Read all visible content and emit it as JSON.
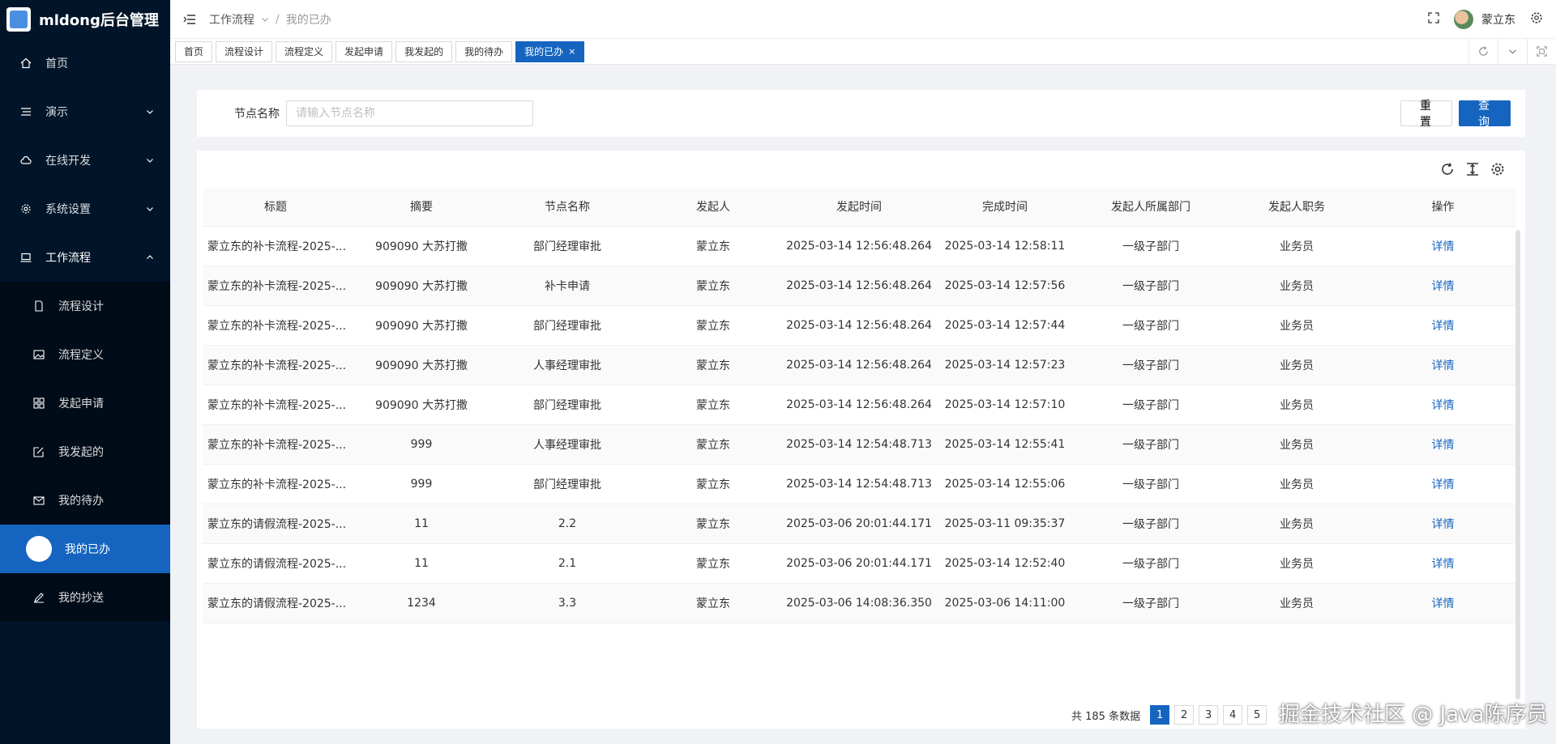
{
  "app": {
    "title": "mldong后台管理"
  },
  "sidebar": {
    "items": [
      {
        "label": "首页",
        "icon": "home-icon"
      },
      {
        "label": "演示",
        "icon": "menu-icon"
      },
      {
        "label": "在线开发",
        "icon": "cloud-icon"
      },
      {
        "label": "系统设置",
        "icon": "gear-icon"
      },
      {
        "label": "工作流程",
        "icon": "laptop-icon"
      }
    ],
    "submenu": [
      {
        "label": "流程设计",
        "icon": "file-icon"
      },
      {
        "label": "流程定义",
        "icon": "image-icon"
      },
      {
        "label": "发起申请",
        "icon": "grid-icon"
      },
      {
        "label": "我发起的",
        "icon": "edit-icon"
      },
      {
        "label": "我的待办",
        "icon": "mail-icon"
      },
      {
        "label": "我的已办",
        "icon": "circle-icon"
      },
      {
        "label": "我的抄送",
        "icon": "pen-icon"
      }
    ]
  },
  "header": {
    "breadcrumb": [
      "工作流程",
      "我的已办"
    ],
    "user": "蒙立东"
  },
  "tabs": [
    "首页",
    "流程设计",
    "流程定义",
    "发起申请",
    "我发起的",
    "我的待办",
    "我的已办"
  ],
  "search": {
    "label": "节点名称",
    "placeholder": "请输入节点名称",
    "reset": "重 置",
    "query": "查 询"
  },
  "table": {
    "columns": [
      "标题",
      "摘要",
      "节点名称",
      "发起人",
      "发起时间",
      "完成时间",
      "发起人所属部门",
      "发起人职务",
      "操作"
    ],
    "rows": [
      [
        "蒙立东的补卡流程-2025-...",
        "909090 大苏打撒",
        "部门经理审批",
        "蒙立东",
        "2025-03-14 12:56:48.264",
        "2025-03-14 12:58:11",
        "一级子部门",
        "业务员",
        "详情"
      ],
      [
        "蒙立东的补卡流程-2025-...",
        "909090 大苏打撒",
        "补卡申请",
        "蒙立东",
        "2025-03-14 12:56:48.264",
        "2025-03-14 12:57:56",
        "一级子部门",
        "业务员",
        "详情"
      ],
      [
        "蒙立东的补卡流程-2025-...",
        "909090 大苏打撒",
        "部门经理审批",
        "蒙立东",
        "2025-03-14 12:56:48.264",
        "2025-03-14 12:57:44",
        "一级子部门",
        "业务员",
        "详情"
      ],
      [
        "蒙立东的补卡流程-2025-...",
        "909090 大苏打撒",
        "人事经理审批",
        "蒙立东",
        "2025-03-14 12:56:48.264",
        "2025-03-14 12:57:23",
        "一级子部门",
        "业务员",
        "详情"
      ],
      [
        "蒙立东的补卡流程-2025-...",
        "909090 大苏打撒",
        "部门经理审批",
        "蒙立东",
        "2025-03-14 12:56:48.264",
        "2025-03-14 12:57:10",
        "一级子部门",
        "业务员",
        "详情"
      ],
      [
        "蒙立东的补卡流程-2025-...",
        "999",
        "人事经理审批",
        "蒙立东",
        "2025-03-14 12:54:48.713",
        "2025-03-14 12:55:41",
        "一级子部门",
        "业务员",
        "详情"
      ],
      [
        "蒙立东的补卡流程-2025-...",
        "999",
        "部门经理审批",
        "蒙立东",
        "2025-03-14 12:54:48.713",
        "2025-03-14 12:55:06",
        "一级子部门",
        "业务员",
        "详情"
      ],
      [
        "蒙立东的请假流程-2025-...",
        "11",
        "2.2",
        "蒙立东",
        "2025-03-06 20:01:44.171",
        "2025-03-11 09:35:37",
        "一级子部门",
        "业务员",
        "详情"
      ],
      [
        "蒙立东的请假流程-2025-...",
        "11",
        "2.1",
        "蒙立东",
        "2025-03-06 20:01:44.171",
        "2025-03-14 12:52:40",
        "一级子部门",
        "业务员",
        "详情"
      ],
      [
        "蒙立东的请假流程-2025-...",
        "1234",
        "3.3",
        "蒙立东",
        "2025-03-06 14:08:36.350",
        "2025-03-06 14:11:00",
        "一级子部门",
        "业务员",
        "详情"
      ]
    ]
  },
  "pagination": {
    "total": "共 185 条数据",
    "pages": [
      "1",
      "2",
      "3",
      "4",
      "5"
    ],
    "current": "1"
  },
  "watermark": "掘金技术社区 @ Java陈序员",
  "colors": {
    "sidebar": "#001529",
    "accent": "#1565c0"
  }
}
